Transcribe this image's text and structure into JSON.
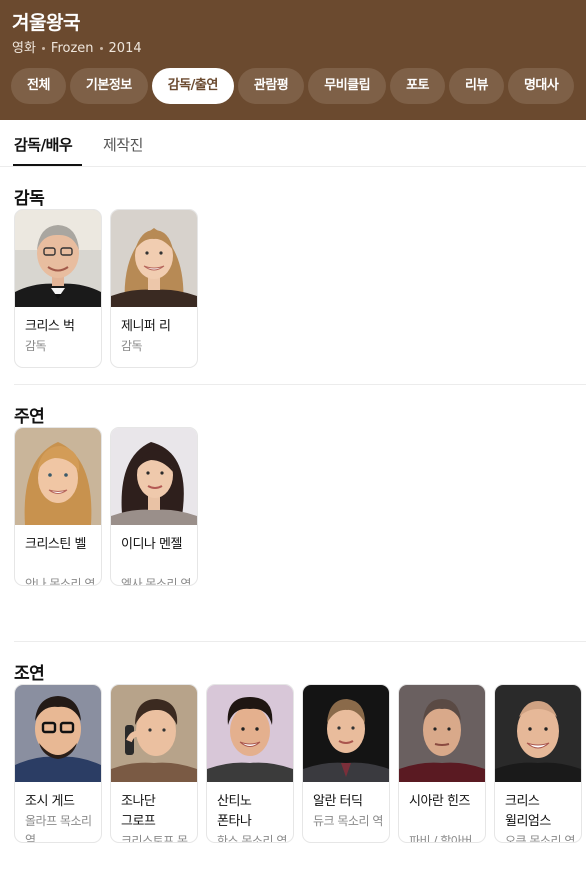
{
  "header": {
    "title": "겨울왕국",
    "meta": [
      "영화",
      "Frozen",
      "2014"
    ],
    "tabs": [
      "전체",
      "기본정보",
      "감독/출연",
      "관람평",
      "무비클립",
      "포토",
      "리뷰",
      "명대사"
    ]
  },
  "subtabs": [
    "감독/배우",
    "제작진"
  ],
  "sections": {
    "directors": {
      "title": "감독",
      "people": [
        {
          "name": "크리스 벅",
          "role": "감독"
        },
        {
          "name": "제니퍼 리",
          "role": "감독"
        }
      ]
    },
    "leads": {
      "title": "주연",
      "people": [
        {
          "name": "크리스틴 벨",
          "role": "안나 목소리 역"
        },
        {
          "name": "이디나 멘젤",
          "role": "엘사 목소리 역"
        }
      ]
    },
    "supporting": {
      "title": "조연",
      "people": [
        {
          "name": "조시 게드",
          "role": "올라프 목소리 역"
        },
        {
          "name": "조나단 그로프",
          "role": "크리스토프 목소..."
        },
        {
          "name": "산티노 폰타나",
          "role": "한스 목소리 역"
        },
        {
          "name": "알란 터딕",
          "role": "듀크 목소리 역"
        },
        {
          "name": "시아란 힌즈",
          "role": "파비 / 할아버지 ..."
        },
        {
          "name": "크리스 윌리엄스",
          "role": "오큰 목소리 역"
        }
      ]
    }
  },
  "colors": {
    "header_bg": "#6b4a2f",
    "tab_bg": "#7e6047",
    "active_tab_bg": "#ffffff",
    "active_tab_text": "#6b4a2f"
  }
}
